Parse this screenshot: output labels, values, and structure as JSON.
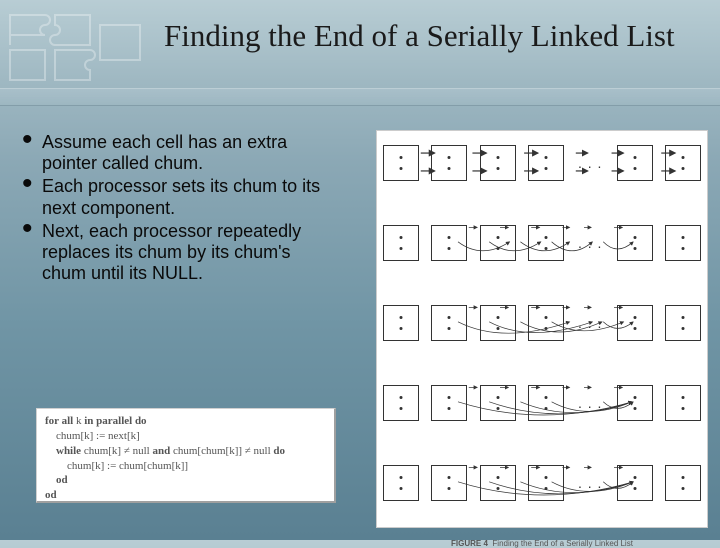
{
  "title": "Finding the End of a Serially Linked List",
  "bullets": {
    "b1": "Assume each cell has an extra pointer called chum.",
    "b2": "Each processor sets its chum to its next component.",
    "b3": "Next, each processor repeatedly  replaces its chum by its chum's chum until its NULL."
  },
  "code": {
    "l1_a": "for all ",
    "l1_b": "k ",
    "l1_c": "in parallel do",
    "l2": "    chum[k] := next[k]",
    "l3_a": "    while ",
    "l3_b": "chum[k] ≠ null ",
    "l3_c": "and ",
    "l3_d": "chum[chum[k]] ≠ null ",
    "l3_e": "do",
    "l4": "        chum[k] := chum[chum[k]]",
    "l5": "    od",
    "l6": "od"
  },
  "diagram": {
    "ellipsis": ". . .",
    "caption_label": "FIGURE 4",
    "caption_text": "Finding the End of a Serially Linked List"
  }
}
